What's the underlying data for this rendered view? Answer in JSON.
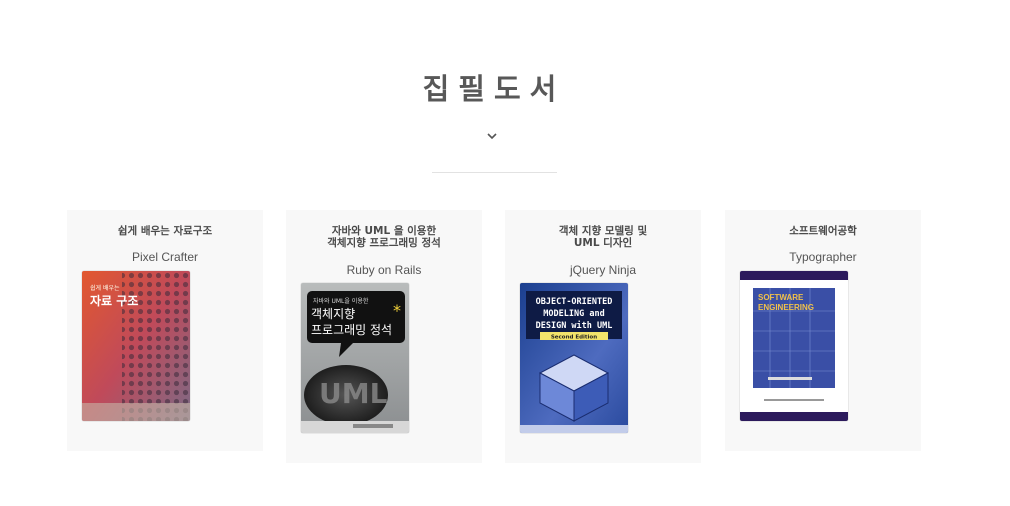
{
  "section": {
    "title": "집필도서"
  },
  "icons": {
    "expand": "chevron-down-icon"
  },
  "books": [
    {
      "title": "쉽게 배우는 자료구조",
      "author": "Pixel Crafter",
      "cover": {
        "small": "쉽게 배우는",
        "main": "자료 구조"
      }
    },
    {
      "title": "자바와 UML 을 이용한\n객체지향 프로그래밍 정석",
      "author": "Ruby on Rails",
      "cover": {
        "small": "자바와 UML을 이용한",
        "line1": "객체지향",
        "line2": "프로그래밍 정석"
      }
    },
    {
      "title": "객체 지향 모델링 및\nUML 디자인",
      "author": "jQuery Ninja",
      "cover": {
        "line1": "OBJECT-ORIENTED",
        "line2": "MODELING and",
        "line3": "DESIGN with UML",
        "edition": "Second Edition"
      }
    },
    {
      "title": "소프트웨어공학",
      "author": "Typographer",
      "cover": {
        "line1": "SOFTWARE",
        "line2": "ENGINEERING"
      }
    }
  ],
  "colors": {
    "title": "#585858",
    "card_bg": "#f8f8f8"
  }
}
